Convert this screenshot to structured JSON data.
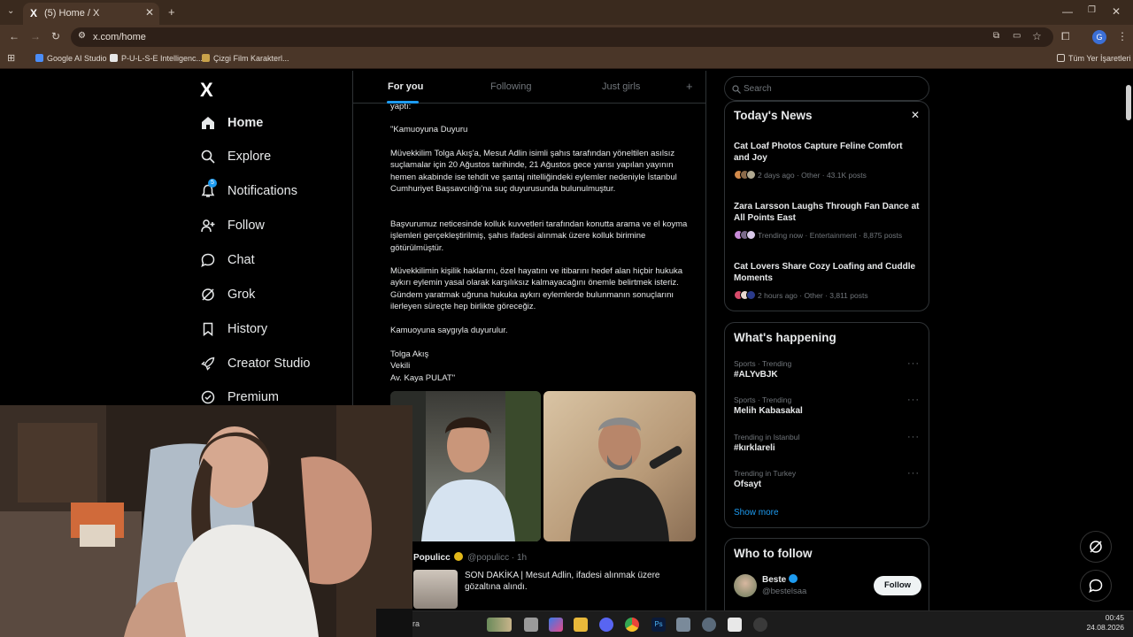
{
  "browser": {
    "tab_title": "(5) Home / X",
    "tab_logo": "X",
    "url": "x.com/home",
    "bookmarks": [
      "Google AI Studio",
      "P-U-L-S-E Intelligenc...",
      "Çizgi Film Karakterl..."
    ],
    "all_bookmarks": "Tüm Yer İşaretleri",
    "profile_initial": "G"
  },
  "nav": {
    "logo": "X",
    "items": [
      {
        "label": "Home",
        "icon": "home-icon",
        "glyph": "⌂"
      },
      {
        "label": "Explore",
        "icon": "search-icon",
        "glyph": "⚲"
      },
      {
        "label": "Notifications",
        "icon": "bell-icon",
        "glyph": "🔔"
      },
      {
        "label": "Follow",
        "icon": "person-add-icon",
        "glyph": "⚇"
      },
      {
        "label": "Chat",
        "icon": "chat-icon",
        "glyph": "◯"
      },
      {
        "label": "Grok",
        "icon": "grok-icon",
        "glyph": "⊘"
      },
      {
        "label": "History",
        "icon": "bookmark-icon",
        "glyph": "⌑"
      },
      {
        "label": "Creator Studio",
        "icon": "rocket-icon",
        "glyph": "➶"
      },
      {
        "label": "Premium",
        "icon": "verified-icon",
        "glyph": "✓"
      }
    ],
    "notification_badge": "5"
  },
  "feed": {
    "tabs": [
      "For you",
      "Following",
      "Just girls"
    ],
    "add_tab": "+",
    "post": {
      "lines": [
        "yaptı:",
        "\"Kamuoyuna Duyuru",
        "Müvekkilim Tolga Akış'a, Mesut Adlin isimli şahıs tarafından yöneltilen asılsız suçlamalar için 20 Ağustos tarihinde, 21 Ağustos gece yarısı yapılan yayının hemen akabinde ise tehdit ve şantaj nitelliğindeki eylemler nedeniyle İstanbul Cumhuriyet Başsavcılığı'na suç duyurusunda bulunulmuştur.",
        "Başvurumuz neticesinde kolluk kuvvetleri tarafından konutta arama ve el koyma işlemleri gerçekleştirilmiş, şahıs ifadesi alınmak üzere kolluk birimine götürülmüştür.",
        "Müvekkilimin kişilik haklarını, özel hayatını ve itibarını hedef alan hiçbir hukuka aykırı eylemin yasal olarak karşılıksız kalmayacağını önemle belirtmek isteriz. Gündem yaratmak uğruna hukuka aykırı eylemlerde bulunmanın sonuçlarını ilerleyen süreçte hep birlikte göreceğiz.",
        "Kamuoyuna saygıyla duyurulur.",
        "Tolga Akış\nVekili\nAv. Kaya PULAT\""
      ]
    },
    "next_post": {
      "author": "Populicc",
      "handle": "@populicc",
      "time": "· 1h",
      "text": "SON DAKİKA | Mesut Adlin, ifadesi alınmak üzere gözaltına alındı."
    }
  },
  "right": {
    "search_placeholder": "Search",
    "news": {
      "title": "Today's News",
      "items": [
        {
          "title": "Cat Loaf Photos Capture Feline Comfort and Joy",
          "meta": "2 days ago · Other · 43.1K posts"
        },
        {
          "title": "Zara Larsson Laughs Through Fan Dance at All Points East",
          "meta": "Trending now · Entertainment · 8,875 posts"
        },
        {
          "title": "Cat Lovers Share Cozy Loafing and Cuddle Moments",
          "meta": "2 hours ago · Other · 3,811 posts"
        }
      ]
    },
    "happening": {
      "title": "What's happening",
      "items": [
        {
          "cat": "Sports · Trending",
          "name": "#ALYvBJK"
        },
        {
          "cat": "Sports · Trending",
          "name": "Melih Kabasakal"
        },
        {
          "cat": "Trending in Istanbul",
          "name": "#kırklareli"
        },
        {
          "cat": "Trending in Turkey",
          "name": "Ofsayt"
        }
      ],
      "show_more": "Show more"
    },
    "who_to_follow": {
      "title": "Who to follow",
      "name": "Beste",
      "handle": "@bestelsaa",
      "button": "Follow"
    }
  },
  "taskbar": {
    "time": "00:45",
    "date": "24.08.2026",
    "search_fragment": "ra"
  },
  "colors": {
    "accent": "#1d9bf0",
    "background": "#000000",
    "chrome": "#4a3628"
  }
}
